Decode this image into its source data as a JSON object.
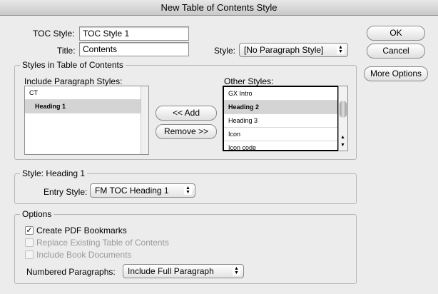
{
  "window": {
    "title": "New Table of Contents Style"
  },
  "toc_style": {
    "label": "TOC Style:",
    "value": "TOC Style 1"
  },
  "title_field": {
    "label": "Title:",
    "value": "Contents"
  },
  "style_popup": {
    "label": "Style:",
    "value": "[No Paragraph Style]"
  },
  "buttons": {
    "ok": "OK",
    "cancel": "Cancel",
    "more_options": "More Options",
    "add": "<< Add",
    "remove": "Remove >>"
  },
  "styles_in_toc": {
    "group_title": "Styles in Table of Contents",
    "include_label": "Include Paragraph Styles:",
    "include_items": [
      {
        "label": "CT"
      },
      {
        "label": "Heading 1"
      }
    ],
    "other_label": "Other Styles:",
    "other_items": [
      {
        "label": "GX Intro"
      },
      {
        "label": "Heading 2"
      },
      {
        "label": "Heading 3"
      },
      {
        "label": "Icon"
      },
      {
        "label": "Icon code"
      }
    ]
  },
  "style_group": {
    "title": "Style: Heading 1",
    "entry_label": "Entry Style:",
    "entry_value": "FM TOC Heading 1"
  },
  "options": {
    "title": "Options",
    "create_pdf": {
      "label": "Create PDF Bookmarks",
      "checked": true
    },
    "replace_existing": {
      "label": "Replace Existing Table of Contents",
      "checked": false
    },
    "include_book": {
      "label": "Include Book Documents",
      "checked": false
    },
    "numbered_label": "Numbered Paragraphs:",
    "numbered_value": "Include Full Paragraph"
  }
}
